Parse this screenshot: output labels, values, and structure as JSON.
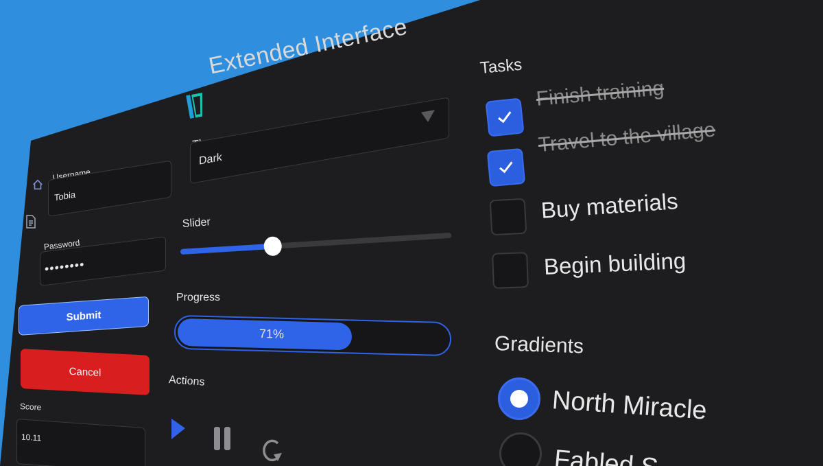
{
  "app": {
    "title": "Extended Interface"
  },
  "sidebar": {
    "items": [
      {
        "icon": "home-icon"
      },
      {
        "icon": "document-icon"
      }
    ]
  },
  "login": {
    "username_label": "Username",
    "username_value": "Tobia",
    "password_label": "Password",
    "password_value": "••••••••",
    "submit_label": "Submit",
    "cancel_label": "Cancel",
    "score_label": "Score",
    "score_value": "10.11"
  },
  "settings": {
    "theme_label": "Theme",
    "theme_value": "Dark",
    "slider_label": "Slider",
    "slider_value": 0.34,
    "progress_label": "Progress",
    "progress_value": 0.71,
    "progress_text": "71%",
    "actions_label": "Actions",
    "actions": [
      {
        "icon": "play-icon"
      },
      {
        "icon": "pause-icon"
      },
      {
        "icon": "restart-icon"
      }
    ]
  },
  "tasks": {
    "heading": "Tasks",
    "items": [
      {
        "label": "Finish training",
        "done": true
      },
      {
        "label": "Travel to the village",
        "done": true
      },
      {
        "label": "Buy materials",
        "done": false
      },
      {
        "label": "Begin building",
        "done": false
      }
    ]
  },
  "gradients": {
    "heading": "Gradients",
    "options": [
      {
        "label": "North Miracle",
        "selected": true
      },
      {
        "label": "Fabled S",
        "selected": false
      }
    ]
  },
  "colors": {
    "background": "#2f8fde",
    "panel": "#1d1d1f",
    "accent": "#2b5fe0",
    "cancel": "#d81e1e"
  }
}
